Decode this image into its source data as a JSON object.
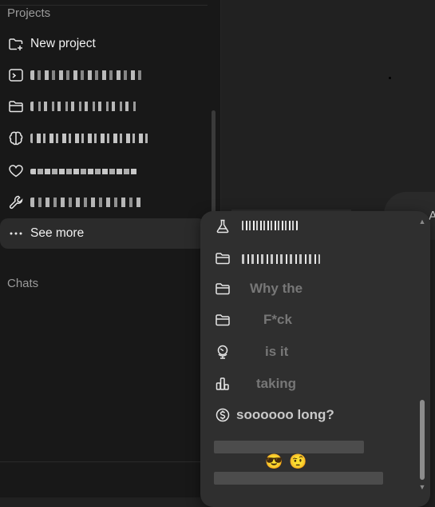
{
  "sidebar": {
    "projects_label": "Projects",
    "new_project_label": "New project",
    "project_icons": [
      "terminal-icon",
      "folder-icon",
      "brain-icon",
      "heart-icon",
      "wrench-icon"
    ],
    "see_more_label": "See more",
    "chats_label": "Chats"
  },
  "main": {
    "bubble_text": "A"
  },
  "dropdown": {
    "items": [
      {
        "icon": "flask-icon",
        "text": ""
      },
      {
        "icon": "folder-icon",
        "text": ""
      },
      {
        "icon": "folder-icon",
        "text": "Why the"
      },
      {
        "icon": "folder-icon",
        "text": "F*ck"
      },
      {
        "icon": "globe-icon",
        "text": "is it"
      },
      {
        "icon": "chart-icon",
        "text": "taking"
      },
      {
        "icon": "dollar-icon",
        "text": "soooooo long?"
      }
    ],
    "emojis": [
      "😎",
      "🤨"
    ]
  }
}
